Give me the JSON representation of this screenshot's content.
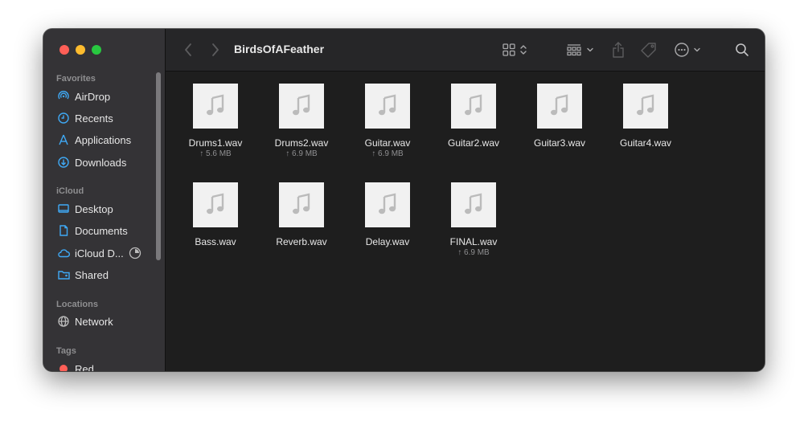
{
  "window": {
    "title": "BirdsOfAFeather"
  },
  "sidebar": {
    "sections": [
      {
        "label": "Favorites",
        "items": [
          {
            "label": "AirDrop",
            "icon": "airdrop-icon"
          },
          {
            "label": "Recents",
            "icon": "clock-icon"
          },
          {
            "label": "Applications",
            "icon": "applications-icon"
          },
          {
            "label": "Downloads",
            "icon": "download-icon"
          }
        ]
      },
      {
        "label": "iCloud",
        "items": [
          {
            "label": "Desktop",
            "icon": "desktop-icon"
          },
          {
            "label": "Documents",
            "icon": "document-icon"
          },
          {
            "label": "iCloud D...",
            "icon": "cloud-icon"
          },
          {
            "label": "Shared",
            "icon": "shared-folder-icon"
          }
        ]
      },
      {
        "label": "Locations",
        "items": [
          {
            "label": "Network",
            "icon": "network-icon"
          }
        ]
      },
      {
        "label": "Tags",
        "items": [
          {
            "label": "Red",
            "icon": "red-tag-icon"
          }
        ]
      }
    ]
  },
  "files": [
    {
      "name": "Drums1.wav",
      "size": "↑ 5.6 MB"
    },
    {
      "name": "Drums2.wav",
      "size": "↑ 6.9 MB"
    },
    {
      "name": "Guitar.wav",
      "size": "↑ 6.9 MB"
    },
    {
      "name": "Guitar2.wav",
      "size": ""
    },
    {
      "name": "Guitar3.wav",
      "size": ""
    },
    {
      "name": "Guitar4.wav",
      "size": ""
    },
    {
      "name": "Bass.wav",
      "size": ""
    },
    {
      "name": "Reverb.wav",
      "size": ""
    },
    {
      "name": "Delay.wav",
      "size": ""
    },
    {
      "name": "FINAL.wav",
      "size": "↑ 6.9 MB"
    }
  ],
  "colors": {
    "accent": "#3fa9f5",
    "tag_red": "#ff5f57"
  }
}
